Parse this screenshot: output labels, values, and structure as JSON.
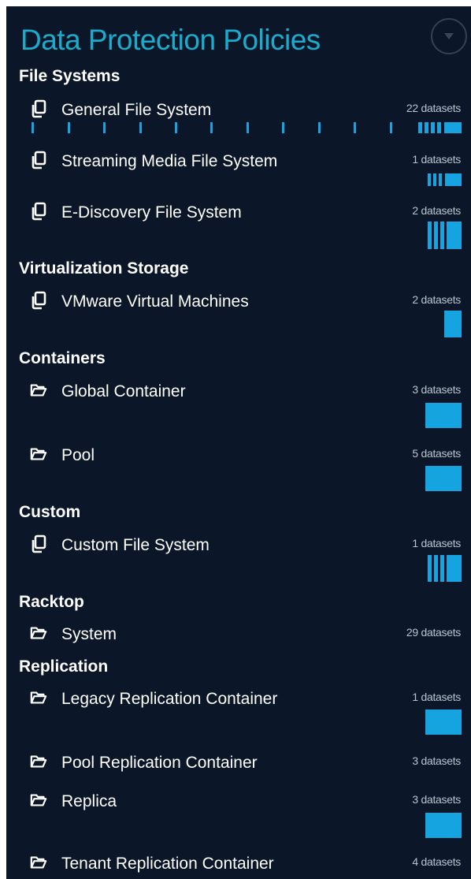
{
  "title": "Data Protection Policies",
  "accent_color": "#1aaccd",
  "bar_color": "#16a4e0",
  "background_color": "#0b1628",
  "sections": [
    {
      "label": "File Systems",
      "items": [
        {
          "label": "General File System",
          "count": "22 datasets",
          "icon": "copy-icon"
        },
        {
          "label": "Streaming Media File System",
          "count": "1 datasets",
          "icon": "copy-icon"
        },
        {
          "label": "E-Discovery File System",
          "count": "2 datasets",
          "icon": "copy-icon"
        }
      ]
    },
    {
      "label": "Virtualization Storage",
      "items": [
        {
          "label": "VMware Virtual Machines",
          "count": "2 datasets",
          "icon": "copy-icon"
        }
      ]
    },
    {
      "label": "Containers",
      "items": [
        {
          "label": "Global Container",
          "count": "3 datasets",
          "icon": "folder-icon"
        },
        {
          "label": "Pool",
          "count": "5 datasets",
          "icon": "folder-icon"
        }
      ]
    },
    {
      "label": "Custom",
      "items": [
        {
          "label": "Custom File System",
          "count": "1 datasets",
          "icon": "copy-icon"
        }
      ]
    },
    {
      "label": "Racktop",
      "items": [
        {
          "label": "System",
          "count": "29 datasets",
          "icon": "folder-icon"
        }
      ]
    },
    {
      "label": "Replication",
      "items": [
        {
          "label": "Legacy Replication Container",
          "count": "1 datasets",
          "icon": "folder-icon"
        },
        {
          "label": "Pool Replication Container",
          "count": "3 datasets",
          "icon": "folder-icon"
        },
        {
          "label": "Replica",
          "count": "3 datasets",
          "icon": "folder-icon"
        },
        {
          "label": "Tenant Replication Container",
          "count": "4 datasets",
          "icon": "folder-icon"
        }
      ]
    }
  ]
}
